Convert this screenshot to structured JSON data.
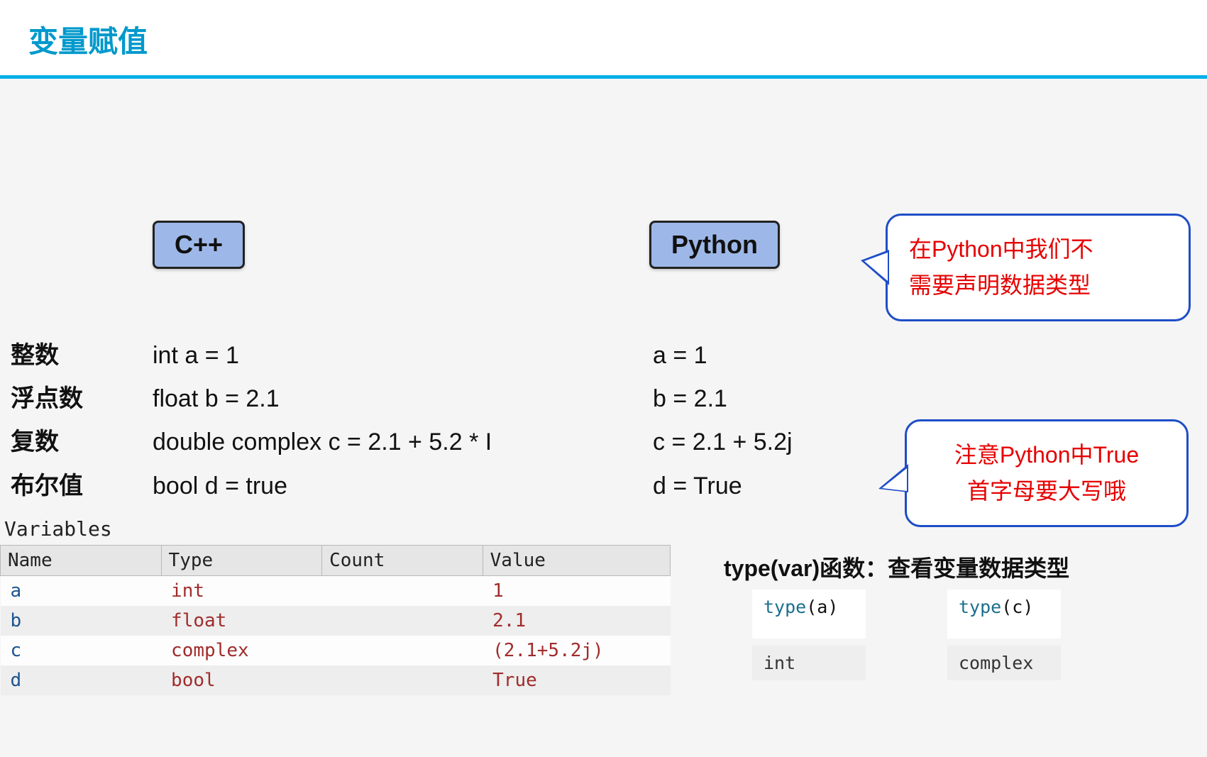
{
  "title": "变量赋值",
  "badges": {
    "cpp": "C++",
    "python": "Python"
  },
  "labels": [
    "整数",
    "浮点数",
    "复数",
    "布尔值"
  ],
  "cpp_lines": [
    "int a = 1",
    "float b = 2.1",
    "double complex c = 2.1 + 5.2 * I",
    "bool d = true"
  ],
  "py_lines": [
    "a = 1",
    "b = 2.1",
    "c = 2.1 + 5.2j",
    "d = True"
  ],
  "callout1_line1": "在Python中我们不",
  "callout1_line2": "需要声明数据类型",
  "callout2_line1": "注意Python中True",
  "callout2_line2": "首字母要大写哦",
  "vars_title": "Variables",
  "vars_headers": [
    "Name",
    "Type",
    "Count",
    "Value"
  ],
  "vars_rows": [
    {
      "name": "a",
      "type": "int",
      "count": "",
      "value": "1"
    },
    {
      "name": "b",
      "type": "float",
      "count": "",
      "value": "2.1"
    },
    {
      "name": "c",
      "type": "complex",
      "count": "",
      "value": "(2.1+5.2j)"
    },
    {
      "name": "d",
      "type": "bool",
      "count": "",
      "value": "True"
    }
  ],
  "type_heading": "type(var)函数：查看变量数据类型",
  "type_snippets": [
    {
      "call_fn": "type",
      "call_arg": "(a)",
      "result": "int"
    },
    {
      "call_fn": "type",
      "call_arg": "(c)",
      "result": "complex"
    }
  ]
}
